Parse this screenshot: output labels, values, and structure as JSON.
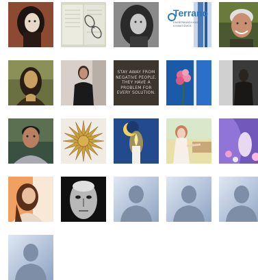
{
  "gallery": {
    "tiles": [
      {
        "id": "portrait-woman-dark-hair",
        "kind": "photo"
      },
      {
        "id": "open-book-glasses",
        "kind": "photo"
      },
      {
        "id": "bw-woman-portrait",
        "kind": "photo"
      },
      {
        "id": "terrano-logo",
        "kind": "logo"
      },
      {
        "id": "smiling-man-gray-hair",
        "kind": "photo"
      },
      {
        "id": "mona-lisa",
        "kind": "photo"
      },
      {
        "id": "man-long-hair",
        "kind": "photo"
      },
      {
        "id": "quote-negative-people",
        "kind": "quote"
      },
      {
        "id": "pink-flowers-blue",
        "kind": "photo"
      },
      {
        "id": "dark-silhouette",
        "kind": "photo"
      },
      {
        "id": "man-gray-shirt",
        "kind": "photo"
      },
      {
        "id": "vergina-sun",
        "kind": "photo"
      },
      {
        "id": "candle-moon",
        "kind": "photo"
      },
      {
        "id": "painted-woman-pastel",
        "kind": "photo"
      },
      {
        "id": "purple-flowers-fairy",
        "kind": "photo"
      },
      {
        "id": "woman-long-hair",
        "kind": "photo"
      },
      {
        "id": "bw-man-close-up",
        "kind": "photo"
      },
      {
        "id": "default-avatar-1",
        "kind": "avatar"
      },
      {
        "id": "default-avatar-2",
        "kind": "avatar"
      },
      {
        "id": "default-avatar-3",
        "kind": "avatar"
      },
      {
        "id": "default-avatar-4",
        "kind": "avatar"
      }
    ],
    "quote_text": "Stay away from negative people. They have a problem for every solution.",
    "logo": {
      "name": "Terrano",
      "tagline": "ΕΝΘΕΡΜΑΝΣΗ ΚΑΙ ΚΛΙΜΑΤΙΣΜΟΣ"
    }
  }
}
